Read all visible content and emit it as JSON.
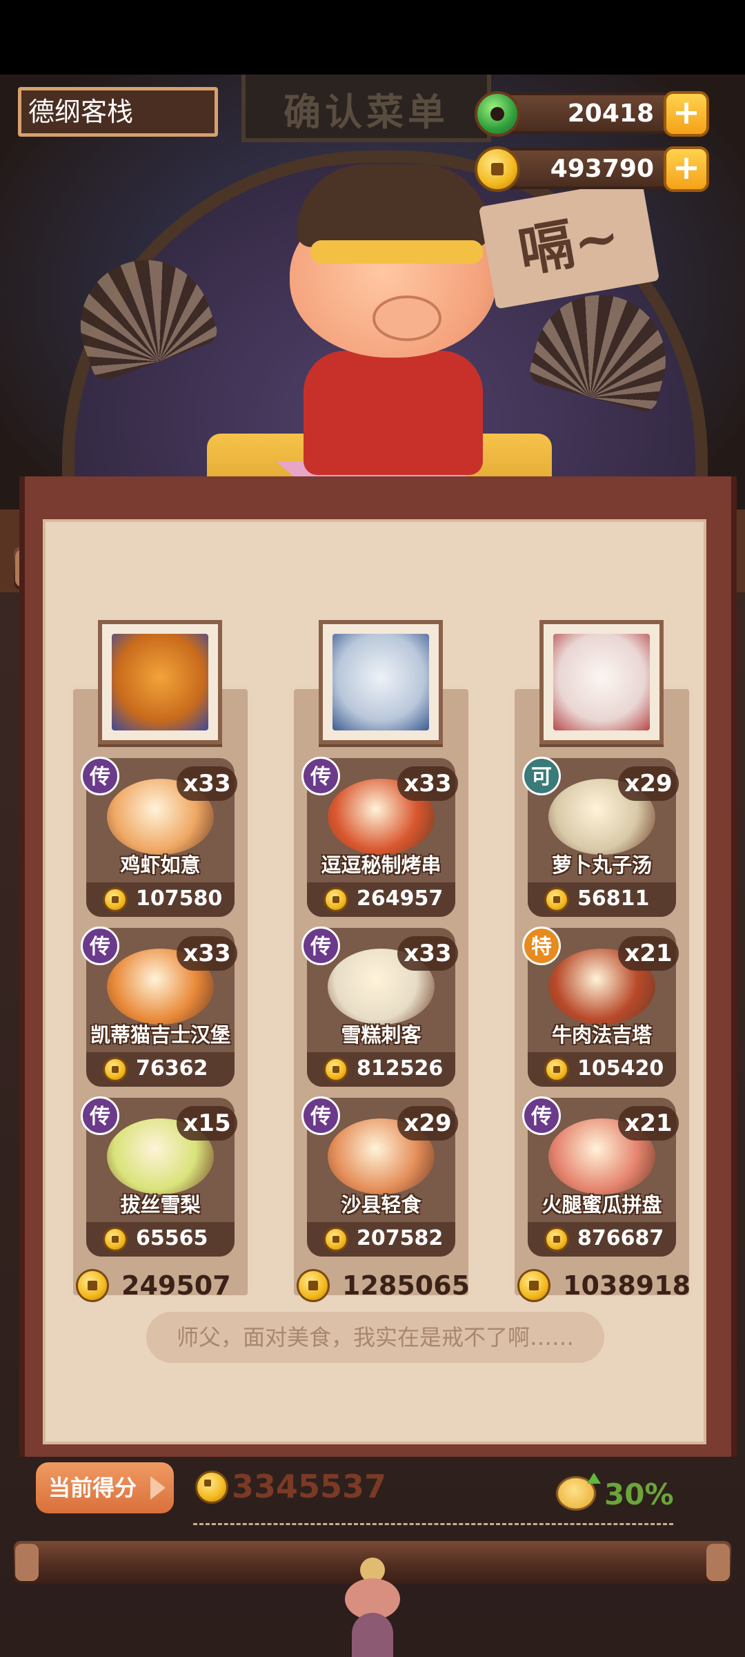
{
  "header": {
    "inn_name": "德纲客栈",
    "sign_text": "确认菜单",
    "jade_amount": "20418",
    "coin_amount": "493790"
  },
  "speech_sign": "嗝~",
  "columns": [
    {
      "portrait": "bear-guest-portrait",
      "dishes": [
        {
          "badge": "传",
          "badge_color": "#6b3a8a",
          "name": "鸡虾如意",
          "qty": "x33",
          "price": "107580",
          "color": "#f0a864"
        },
        {
          "badge": "传",
          "badge_color": "#6b3a8a",
          "name": "凯蒂猫吉士汉堡",
          "qty": "x33",
          "price": "76362",
          "color": "#e98a3a"
        },
        {
          "badge": "传",
          "badge_color": "#6b3a8a",
          "name": "拔丝雪梨",
          "qty": "x15",
          "price": "65565",
          "color": "#d9e37a"
        }
      ],
      "total": "249507"
    },
    {
      "portrait": "silver-hair-guest-portrait",
      "dishes": [
        {
          "badge": "传",
          "badge_color": "#6b3a8a",
          "name": "逗逗秘制烤串",
          "qty": "x33",
          "price": "264957",
          "color": "#d9572f"
        },
        {
          "badge": "传",
          "badge_color": "#6b3a8a",
          "name": "雪糕刺客",
          "qty": "x33",
          "price": "812526",
          "color": "#e7dcc6"
        },
        {
          "badge": "传",
          "badge_color": "#6b3a8a",
          "name": "沙县轻食",
          "qty": "x29",
          "price": "207582",
          "color": "#e58f5a"
        }
      ],
      "total": "1285065"
    },
    {
      "portrait": "white-hair-guest-portrait",
      "dishes": [
        {
          "badge": "可",
          "badge_color": "#3a7a78",
          "name": "萝卜丸子汤",
          "qty": "x29",
          "price": "56811",
          "color": "#d8c9a8"
        },
        {
          "badge": "特",
          "badge_color": "#e78a1f",
          "name": "牛肉法吉塔",
          "qty": "x21",
          "price": "105420",
          "color": "#b84a2a"
        },
        {
          "badge": "传",
          "badge_color": "#6b3a8a",
          "name": "火腿蜜瓜拼盘",
          "qty": "x21",
          "price": "876687",
          "color": "#e6846f"
        }
      ],
      "total": "1038918"
    }
  ],
  "quote": "师父，面对美食，我实在是戒不了啊……",
  "score": {
    "label": "当前得分",
    "value": "3345537",
    "bonus": "30%"
  }
}
